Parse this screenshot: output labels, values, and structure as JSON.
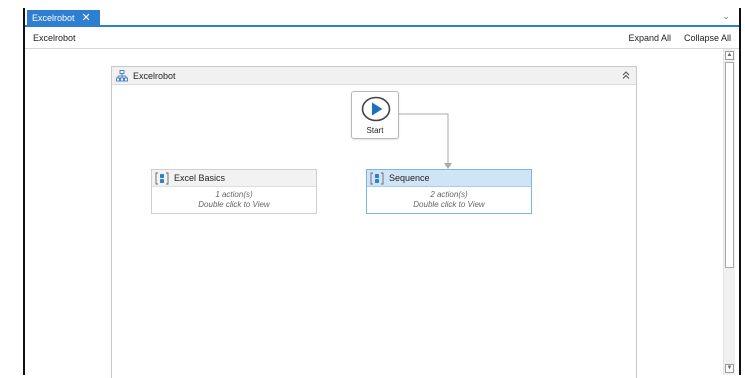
{
  "tab": {
    "title": "Excelrobot",
    "close_glyph": "✕",
    "dropdown_glyph": "⌄"
  },
  "breadcrumb_bar": {
    "breadcrumb": "Excelrobot",
    "expand_all": "Expand All",
    "collapse_all": "Collapse All"
  },
  "container": {
    "title": "Excelrobot",
    "icon": "flowchart-icon",
    "chevron": "double-chevron-up-icon"
  },
  "start_node": {
    "label": "Start",
    "icon": "play-icon"
  },
  "activities": [
    {
      "title": "Excel Basics",
      "count": "1 action(s)",
      "hint": "Double click to View",
      "icon": "sequence-icon",
      "selected": false
    },
    {
      "title": "Sequence",
      "count": "2 action(s)",
      "hint": "Double click to View",
      "icon": "sequence-icon",
      "selected": true
    }
  ],
  "colors": {
    "accent": "#2f7fd0",
    "selected_header": "#cfe5f7",
    "play_fill": "#1f6fbf"
  }
}
